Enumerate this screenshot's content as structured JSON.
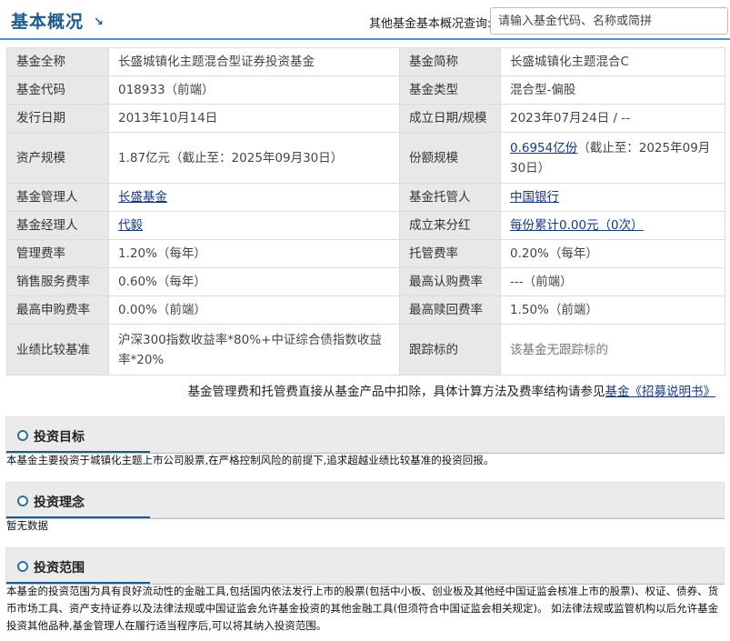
{
  "header": {
    "title": "基本概况",
    "title_arrow": "↘",
    "search_label": "其他基金基本概况查询:",
    "search_placeholder": "请输入基金代码、名称或简拼"
  },
  "info": {
    "rows": [
      {
        "l1": "基金全称",
        "v1": "长盛城镇化主题混合型证券投资基金",
        "l2": "基金简称",
        "v2": "长盛城镇化主题混合C"
      },
      {
        "l1": "基金代码",
        "v1": "018933（前端）",
        "l2": "基金类型",
        "v2": "混合型-偏股"
      },
      {
        "l1": "发行日期",
        "v1": "2013年10月14日",
        "l2": "成立日期/规模",
        "v2": "2023年07月24日 / --"
      },
      {
        "l1": "资产规模",
        "v1": "1.87亿元（截止至：2025年09月30日）",
        "l2": "份额规模",
        "v2_link": "0.6954亿份",
        "v2_rest": "（截止至：2025年09月30日）"
      },
      {
        "l1": "基金管理人",
        "v1_link": "长盛基金",
        "l2": "基金托管人",
        "v2_link": "中国银行"
      },
      {
        "l1": "基金经理人",
        "v1_link": "代毅",
        "l2": "成立来分红",
        "v2_link": "每份累计0.00元（0次）"
      },
      {
        "l1": "管理费率",
        "v1": "1.20%（每年）",
        "l2": "托管费率",
        "v2": "0.20%（每年）"
      },
      {
        "l1": "销售服务费率",
        "v1": "0.60%（每年）",
        "l2": "最高认购费率",
        "v2": "---（前端）"
      },
      {
        "l1": "最高申购费率",
        "v1": "0.00%（前端）",
        "l2": "最高赎回费率",
        "v2": "1.50%（前端）"
      },
      {
        "l1": "业绩比较基准",
        "v1": "沪深300指数收益率*80%+中证综合债指数收益率*20%",
        "l2": "跟踪标的",
        "v2": "该基金无跟踪标的"
      }
    ]
  },
  "note": {
    "text": "基金管理费和托管费直接从基金产品中扣除，具体计算方法及费率结构请参见",
    "link": "基金《招募说明书》"
  },
  "sections": [
    {
      "title": "投资目标",
      "body": "本基金主要投资于城镇化主题上市公司股票,在严格控制风险的前提下,追求超越业绩比较基准的投资回报。"
    },
    {
      "title": "投资理念",
      "body": "暂无数据"
    },
    {
      "title": "投资范围",
      "body": "本基金的投资范围为具有良好流动性的金融工具,包括国内依法发行上市的股票(包括中小板、创业板及其他经中国证监会核准上市的股票)、权证、债券、货币市场工具、资产支持证券以及法律法规或中国证监会允许基金投资的其他金融工具(但须符合中国证监会相关规定)。 如法律法规或监管机构以后允许基金投资其他品种,基金管理人在履行适当程序后,可以将其纳入投资范围。"
    }
  ],
  "colors": {
    "accent": "#1f5a8c",
    "link": "#173a7a",
    "label_bg": "#e8e8e8",
    "section_bg": "#ebebeb"
  }
}
